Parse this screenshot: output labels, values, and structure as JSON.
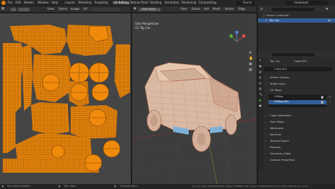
{
  "topbar": {
    "menus": [
      "File",
      "Edit",
      "Render",
      "Window",
      "Help"
    ],
    "workspaces": [
      "Layout",
      "Modeling",
      "Sculpting",
      "UV Editing",
      "Texture Paint",
      "Shading",
      "Animation",
      "Rendering",
      "Compositing"
    ],
    "active_workspace": "UV Editing",
    "scene_label": "Scene",
    "viewlayer_label": "ViewLayer"
  },
  "uv_header": {
    "menus": [
      "View",
      "Select",
      "Image",
      "UV"
    ],
    "image_name": ""
  },
  "viewport_header": {
    "mode": "Edit Mode",
    "menus": [
      "View",
      "Select",
      "Add",
      "Mesh",
      "Vertex",
      "Edge"
    ],
    "view_name": "User Perspective",
    "object_name": "(1) Toy Car"
  },
  "outliner": {
    "collection": "Scene Collection",
    "object": "Toy Car"
  },
  "properties": {
    "object_label": "Toy Car",
    "mesh_label": "Cube.001",
    "data_field": "Cube.001",
    "sections": [
      "Vertex Groups",
      "Shape Keys",
      "UV Maps"
    ],
    "uv_maps": [
      "UVMap",
      "UVMap.001"
    ],
    "sections_lower": [
      "Color Attributes",
      "Face Maps",
      "Attributes",
      "Normals",
      "Texture Space",
      "Remesh",
      "Geometry Data",
      "Custom Properties"
    ]
  },
  "status": {
    "left": "Set Active Modifier",
    "mid1": "Pan View",
    "mid2": "Context Menu",
    "right": "Toy Car | Verts 28,096/28,096 | Edges 55,588/57,292 | Faces 27,564/29,244 | Tris 57,192 | Objects 1/1 | 3.4.0"
  },
  "colors": {
    "uv_orange": "#f08a0c",
    "selection": "#ff8c1a",
    "active_blue": "#335f99"
  }
}
